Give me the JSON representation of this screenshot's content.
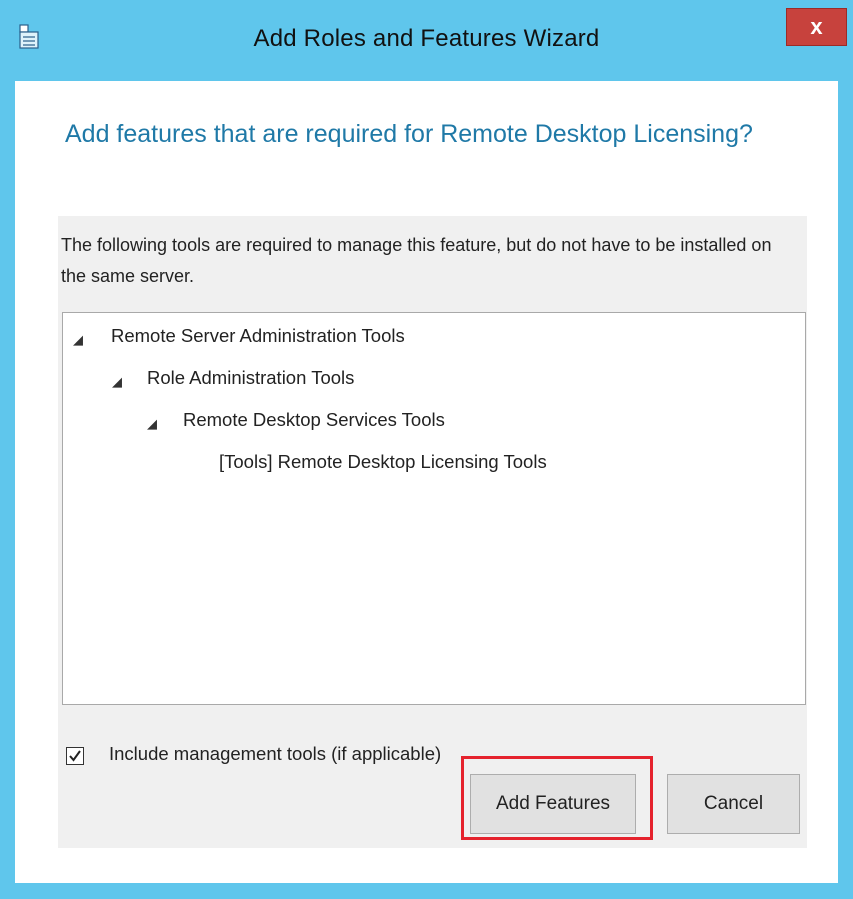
{
  "window": {
    "title": "Add Roles and Features Wizard",
    "close_label": "x"
  },
  "dialog": {
    "heading": "Add features that are required for Remote Desktop Licensing?",
    "description": "The following tools are required to manage this feature, but do not have to be installed on the same server.",
    "tree": [
      {
        "label": "Remote Server Administration Tools",
        "level": 0,
        "expanded": true
      },
      {
        "label": "Role Administration Tools",
        "level": 1,
        "expanded": true
      },
      {
        "label": "Remote Desktop Services Tools",
        "level": 2,
        "expanded": true
      },
      {
        "label": "[Tools] Remote Desktop Licensing Tools",
        "level": 3,
        "expanded": false
      }
    ],
    "include_tools": {
      "label": "Include management tools (if applicable)",
      "checked": true
    },
    "buttons": {
      "add_features": "Add Features",
      "cancel": "Cancel"
    }
  },
  "colors": {
    "frame": "#5fc6ec",
    "close": "#c7423d",
    "heading": "#1f79a7",
    "highlight": "#e5222d"
  }
}
